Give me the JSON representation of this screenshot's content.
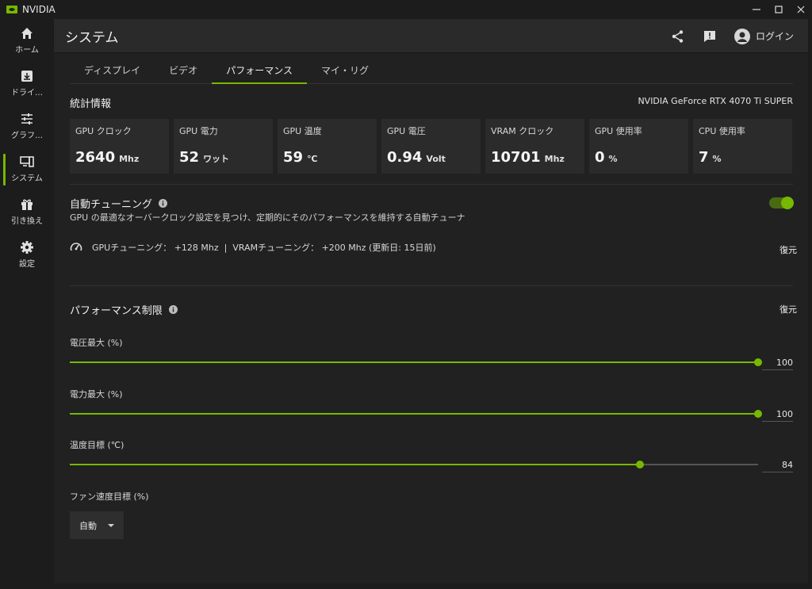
{
  "window": {
    "title": "NVIDIA"
  },
  "nav": {
    "items": [
      {
        "label": "ホーム",
        "icon": "home-icon"
      },
      {
        "label": "ドライ…",
        "icon": "download-icon"
      },
      {
        "label": "グラフ…",
        "icon": "sliders-icon"
      },
      {
        "label": "システム",
        "icon": "system-icon",
        "active": true
      },
      {
        "label": "引き換え",
        "icon": "gift-icon"
      },
      {
        "label": "設定",
        "icon": "gear-icon"
      }
    ]
  },
  "header": {
    "title": "システム",
    "login_label": "ログイン"
  },
  "tabs": [
    {
      "label": "ディスプレイ"
    },
    {
      "label": "ビデオ"
    },
    {
      "label": "パフォーマンス",
      "active": true
    },
    {
      "label": "マイ・リグ"
    }
  ],
  "stats": {
    "title": "統計情報",
    "gpu_name": "NVIDIA GeForce RTX 4070 Ti SUPER",
    "cards": [
      {
        "label": "GPU クロック",
        "value": "2640",
        "unit": "Mhz"
      },
      {
        "label": "GPU 電力",
        "value": "52",
        "unit": "ワット"
      },
      {
        "label": "GPU 温度",
        "value": "59",
        "unit": "℃"
      },
      {
        "label": "GPU 電圧",
        "value": "0.94",
        "unit": "Volt"
      },
      {
        "label": "VRAM クロック",
        "value": "10701",
        "unit": "Mhz"
      },
      {
        "label": "GPU 使用率",
        "value": "0",
        "unit": "%"
      },
      {
        "label": "CPU 使用率",
        "value": "7",
        "unit": "%"
      }
    ]
  },
  "auto_tuning": {
    "title": "自動チューニング",
    "description": "GPU の最適なオーバークロック設定を見つけ、定期的にそのパフォーマンスを維持する自動チューナ",
    "enabled": true,
    "status_text": "GPUチューニング： +128 Mhz  |  VRAMチューニング： +200 Mhz (更新日: 15日前)",
    "restore_label": "復元"
  },
  "performance_limits": {
    "title": "パフォーマンス制限",
    "restore_label": "復元",
    "sliders": [
      {
        "label": "電圧最大 (%)",
        "value": "100",
        "fraction": 1.0
      },
      {
        "label": "電力最大 (%)",
        "value": "100",
        "fraction": 1.0
      },
      {
        "label": "温度目標 (℃)",
        "value": "84",
        "fraction": 0.828
      }
    ],
    "fan": {
      "label": "ファン速度目標 (%)",
      "selected": "自動"
    }
  },
  "colors": {
    "accent": "#76b900",
    "panel": "#212121",
    "card": "#2b2b2b"
  }
}
